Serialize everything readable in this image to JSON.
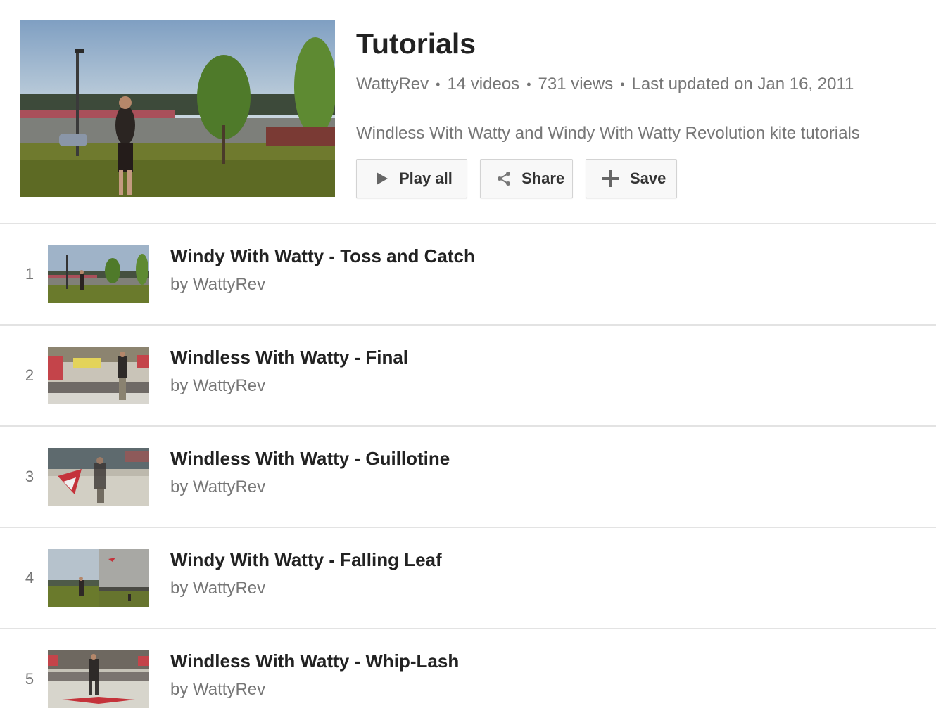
{
  "playlist": {
    "title": "Tutorials",
    "owner": "WattyRev",
    "video_count": "14 videos",
    "views": "731 views",
    "updated": "Last updated on Jan 16, 2011",
    "description": "Windless With Watty and Windy With Watty Revolution kite tutorials",
    "thumbnail_icon": "playlist-thumbnail-image"
  },
  "actions": {
    "play_all": "Play all",
    "share": "Share",
    "save": "Save"
  },
  "videos": [
    {
      "index": "1",
      "title": "Windy With Watty - Toss and Catch",
      "byline": "by WattyRev"
    },
    {
      "index": "2",
      "title": "Windless With Watty - Final",
      "byline": "by WattyRev"
    },
    {
      "index": "3",
      "title": "Windless With Watty - Guillotine",
      "byline": "by WattyRev"
    },
    {
      "index": "4",
      "title": "Windy With Watty - Falling Leaf",
      "byline": "by WattyRev"
    },
    {
      "index": "5",
      "title": "Windless With Watty - Whip-Lash",
      "byline": "by WattyRev"
    }
  ],
  "colors": {
    "title_text": "#222222",
    "secondary_text": "#767676",
    "divider": "#e3e3e3",
    "button_bg": "#f8f8f8"
  }
}
